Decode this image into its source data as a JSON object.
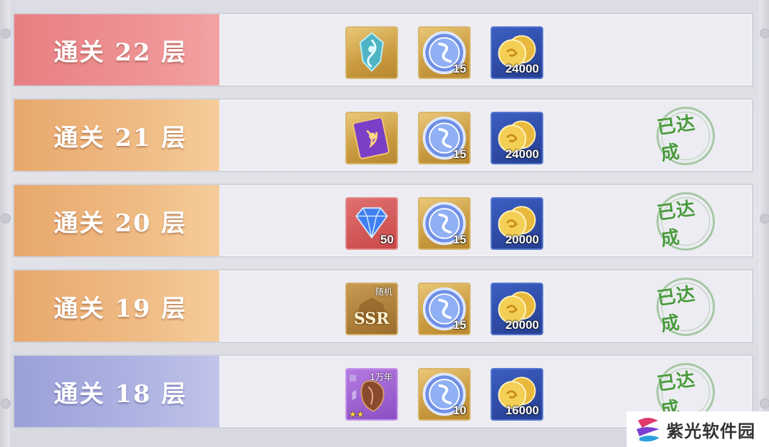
{
  "rows": [
    {
      "title": "通关 22 层",
      "banner_color": "red",
      "rewards": [
        {
          "icon": "spirit-crest-icon",
          "quantity": ""
        },
        {
          "icon": "soul-coin-icon",
          "quantity": "15"
        },
        {
          "icon": "gold-coins-icon",
          "quantity": "24000"
        }
      ],
      "achieved": false,
      "stamp_text": ""
    },
    {
      "title": "通关 21 层",
      "banner_color": "orange",
      "rewards": [
        {
          "icon": "purple-card-icon",
          "quantity": ""
        },
        {
          "icon": "soul-coin-icon",
          "quantity": "15"
        },
        {
          "icon": "gold-coins-icon",
          "quantity": "24000"
        }
      ],
      "achieved": true,
      "stamp_text": "已达成"
    },
    {
      "title": "通关 20 层",
      "banner_color": "orange",
      "rewards": [
        {
          "icon": "diamond-icon",
          "quantity": "50"
        },
        {
          "icon": "soul-coin-icon",
          "quantity": "15"
        },
        {
          "icon": "gold-coins-icon",
          "quantity": "20000"
        }
      ],
      "achieved": true,
      "stamp_text": "已达成"
    },
    {
      "title": "通关 19 层",
      "banner_color": "orange",
      "rewards": [
        {
          "icon": "random-ssr-icon",
          "quantity": "",
          "label_top": "随机",
          "label_main": "SSR"
        },
        {
          "icon": "soul-coin-icon",
          "quantity": "15"
        },
        {
          "icon": "gold-coins-icon",
          "quantity": "20000"
        }
      ],
      "achieved": true,
      "stamp_text": "已达成"
    },
    {
      "title": "通关 18 层",
      "banner_color": "purple",
      "rewards": [
        {
          "icon": "soul-bone-icon",
          "quantity": "",
          "label_top": "1万年",
          "stars": "★★"
        },
        {
          "icon": "soul-coin-icon",
          "quantity": "10"
        },
        {
          "icon": "gold-coins-icon",
          "quantity": "16000"
        }
      ],
      "achieved": true,
      "stamp_text": "已达成"
    }
  ],
  "watermark": {
    "text": "紫光软件园"
  },
  "colors": {
    "stamp_green": "#4a9a3e",
    "banner_red": "#ee9193",
    "banner_orange": "#efbb84",
    "banner_purple": "#aeb3e2"
  }
}
